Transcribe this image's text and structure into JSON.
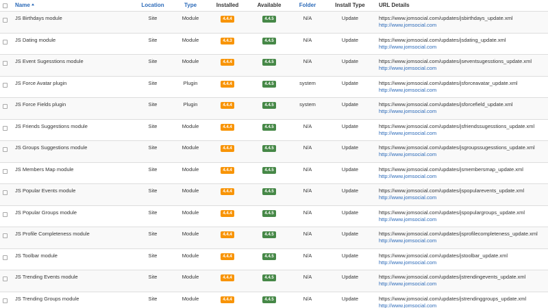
{
  "header": {
    "name": "Name",
    "location": "Location",
    "type": "Type",
    "installed": "Installed",
    "available": "Available",
    "folder": "Folder",
    "install_type": "Install Type",
    "url_details": "URL Details"
  },
  "colors": {
    "link": "#2a69b8",
    "badge_installed": "#f89406",
    "badge_available": "#468847"
  },
  "rows": [
    {
      "name": "JS Birthdays module",
      "location": "Site",
      "type": "Module",
      "installed": "4.4.4",
      "available": "4.4.5",
      "folder": "N/A",
      "install_type": "Update",
      "url": "https://www.jomsocial.com/updates/jsbirthdays_update.xml",
      "site": "http://www.jomsocial.com"
    },
    {
      "name": "JS Dating module",
      "location": "Site",
      "type": "Module",
      "installed": "4.4.3",
      "available": "4.4.5",
      "folder": "N/A",
      "install_type": "Update",
      "url": "https://www.jomsocial.com/updates/jsdating_update.xml",
      "site": "http://www.jomsocial.com"
    },
    {
      "name": "JS Event Sugesstions module",
      "location": "Site",
      "type": "Module",
      "installed": "4.4.4",
      "available": "4.4.5",
      "folder": "N/A",
      "install_type": "Update",
      "url": "https://www.jomsocial.com/updates/jseventsugesstions_update.xml",
      "site": "http://www.jomsocial.com"
    },
    {
      "name": "JS Force Avatar plugin",
      "location": "Site",
      "type": "Plugin",
      "installed": "4.4.4",
      "available": "4.4.5",
      "folder": "system",
      "install_type": "Update",
      "url": "https://www.jomsocial.com/updates/jsforceavatar_update.xml",
      "site": "http://www.jomsocial.com"
    },
    {
      "name": "JS Force Fields plugin",
      "location": "Site",
      "type": "Plugin",
      "installed": "4.4.4",
      "available": "4.4.5",
      "folder": "system",
      "install_type": "Update",
      "url": "https://www.jomsocial.com/updates/jsforcefield_update.xml",
      "site": "http://www.jomsocial.com"
    },
    {
      "name": "JS Friends Suggestions module",
      "location": "Site",
      "type": "Module",
      "installed": "4.4.4",
      "available": "4.4.5",
      "folder": "N/A",
      "install_type": "Update",
      "url": "https://www.jomsocial.com/updates/jsfriendssugesstions_update.xml",
      "site": "http://www.jomsocial.com"
    },
    {
      "name": "JS Groups Suggestions module",
      "location": "Site",
      "type": "Module",
      "installed": "4.4.4",
      "available": "4.4.5",
      "folder": "N/A",
      "install_type": "Update",
      "url": "https://www.jomsocial.com/updates/jsgroupssugesstions_update.xml",
      "site": "http://www.jomsocial.com"
    },
    {
      "name": "JS Members Map module",
      "location": "Site",
      "type": "Module",
      "installed": "4.4.4",
      "available": "4.4.5",
      "folder": "N/A",
      "install_type": "Update",
      "url": "https://www.jomsocial.com/updates/jsmembersmap_update.xml",
      "site": "http://www.jomsocial.com"
    },
    {
      "name": "JS Popular Events module",
      "location": "Site",
      "type": "Module",
      "installed": "4.4.4",
      "available": "4.4.5",
      "folder": "N/A",
      "install_type": "Update",
      "url": "https://www.jomsocial.com/updates/jspopularevents_update.xml",
      "site": "http://www.jomsocial.com"
    },
    {
      "name": "JS Popular Groups module",
      "location": "Site",
      "type": "Module",
      "installed": "4.4.4",
      "available": "4.4.5",
      "folder": "N/A",
      "install_type": "Update",
      "url": "https://www.jomsocial.com/updates/jspopulargroups_update.xml",
      "site": "http://www.jomsocial.com"
    },
    {
      "name": "JS Profile Completeness module",
      "location": "Site",
      "type": "Module",
      "installed": "4.4.4",
      "available": "4.4.5",
      "folder": "N/A",
      "install_type": "Update",
      "url": "https://www.jomsocial.com/updates/jsprofilecompleteness_update.xml",
      "site": "http://www.jomsocial.com"
    },
    {
      "name": "JS Toolbar module",
      "location": "Site",
      "type": "Module",
      "installed": "4.4.4",
      "available": "4.4.5",
      "folder": "N/A",
      "install_type": "Update",
      "url": "https://www.jomsocial.com/updates/jstoolbar_update.xml",
      "site": "http://www.jomsocial.com"
    },
    {
      "name": "JS Trending Events module",
      "location": "Site",
      "type": "Module",
      "installed": "4.4.4",
      "available": "4.4.5",
      "folder": "N/A",
      "install_type": "Update",
      "url": "https://www.jomsocial.com/updates/jstrendingevents_update.xml",
      "site": "http://www.jomsocial.com"
    },
    {
      "name": "JS Trending Groups module",
      "location": "Site",
      "type": "Module",
      "installed": "4.4.4",
      "available": "4.4.5",
      "folder": "N/A",
      "install_type": "Update",
      "url": "https://www.jomsocial.com/updates/jstrendinggroups_update.xml",
      "site": "http://www.jomsocial.com"
    }
  ]
}
